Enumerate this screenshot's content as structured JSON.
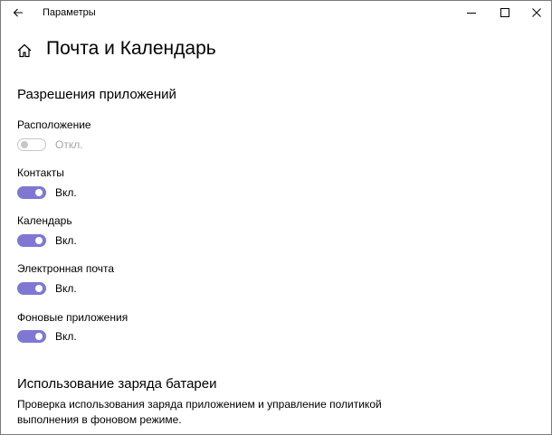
{
  "window": {
    "title": "Параметры"
  },
  "page": {
    "title": "Почта и Календарь"
  },
  "sections": {
    "permissions_title": "Разрешения приложений",
    "battery_title": "Использование заряда батареи",
    "battery_description": "Проверка использования заряда приложением и управление политикой выполнения в фоновом режиме."
  },
  "permissions": [
    {
      "label": "Расположение",
      "state": "Откл.",
      "on": false,
      "enabled": false
    },
    {
      "label": "Контакты",
      "state": "Вкл.",
      "on": true,
      "enabled": true
    },
    {
      "label": "Календарь",
      "state": "Вкл.",
      "on": true,
      "enabled": true
    },
    {
      "label": "Электронная почта",
      "state": "Вкл.",
      "on": true,
      "enabled": true
    },
    {
      "label": "Фоновые приложения",
      "state": "Вкл.",
      "on": true,
      "enabled": true
    }
  ],
  "icons": {
    "back": "back-arrow-icon",
    "home": "home-icon",
    "minimize": "minimize-icon",
    "maximize": "maximize-icon",
    "close": "close-icon"
  },
  "colors": {
    "toggle_on": "#7f78d3",
    "toggle_off_border": "#c6c6c6",
    "disabled_text": "#a6a6a6"
  }
}
